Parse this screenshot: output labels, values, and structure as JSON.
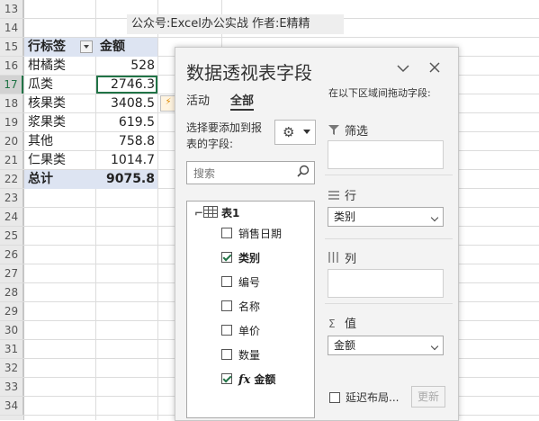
{
  "notice": "公众号:Excel办公实战  作者:E精精",
  "row_numbers": [
    "13",
    "14",
    "15",
    "16",
    "17",
    "18",
    "19",
    "20",
    "21",
    "22",
    "23",
    "24",
    "25",
    "26",
    "27",
    "28",
    "29",
    "30",
    "31",
    "32",
    "33",
    "34"
  ],
  "active_row": "17",
  "pivot": {
    "header": {
      "label": "行标签",
      "value": "金额"
    },
    "rows": [
      {
        "label": "柑橘类",
        "value": "528"
      },
      {
        "label": "瓜类",
        "value": "2746.3"
      },
      {
        "label": "核果类",
        "value": "3408.5"
      },
      {
        "label": "浆果类",
        "value": "619.5"
      },
      {
        "label": "其他",
        "value": "758.8"
      },
      {
        "label": "仁果类",
        "value": "1014.7"
      }
    ],
    "total": {
      "label": "总计",
      "value": "9075.8"
    }
  },
  "pane": {
    "title": "数据透视表字段",
    "tabs": [
      "活动",
      "全部"
    ],
    "active_tab": "全部",
    "hint": "选择要添加到报表的字段:",
    "search_placeholder": "搜索",
    "table_name": "表1",
    "fields": [
      {
        "name": "销售日期",
        "checked": false,
        "fx": false
      },
      {
        "name": "类别",
        "checked": true,
        "fx": false
      },
      {
        "name": "编号",
        "checked": false,
        "fx": false
      },
      {
        "name": "名称",
        "checked": false,
        "fx": false
      },
      {
        "name": "单价",
        "checked": false,
        "fx": false
      },
      {
        "name": "数量",
        "checked": false,
        "fx": false
      },
      {
        "name": "金额",
        "checked": true,
        "fx": true
      }
    ],
    "drag_hint": "在以下区域间拖动字段:",
    "areas": {
      "filter": "筛选",
      "rows": "行",
      "rows_item": "类别",
      "columns": "列",
      "values": "值",
      "values_item": "金额"
    },
    "defer_label": "延迟布局...",
    "update_label": "更新"
  }
}
